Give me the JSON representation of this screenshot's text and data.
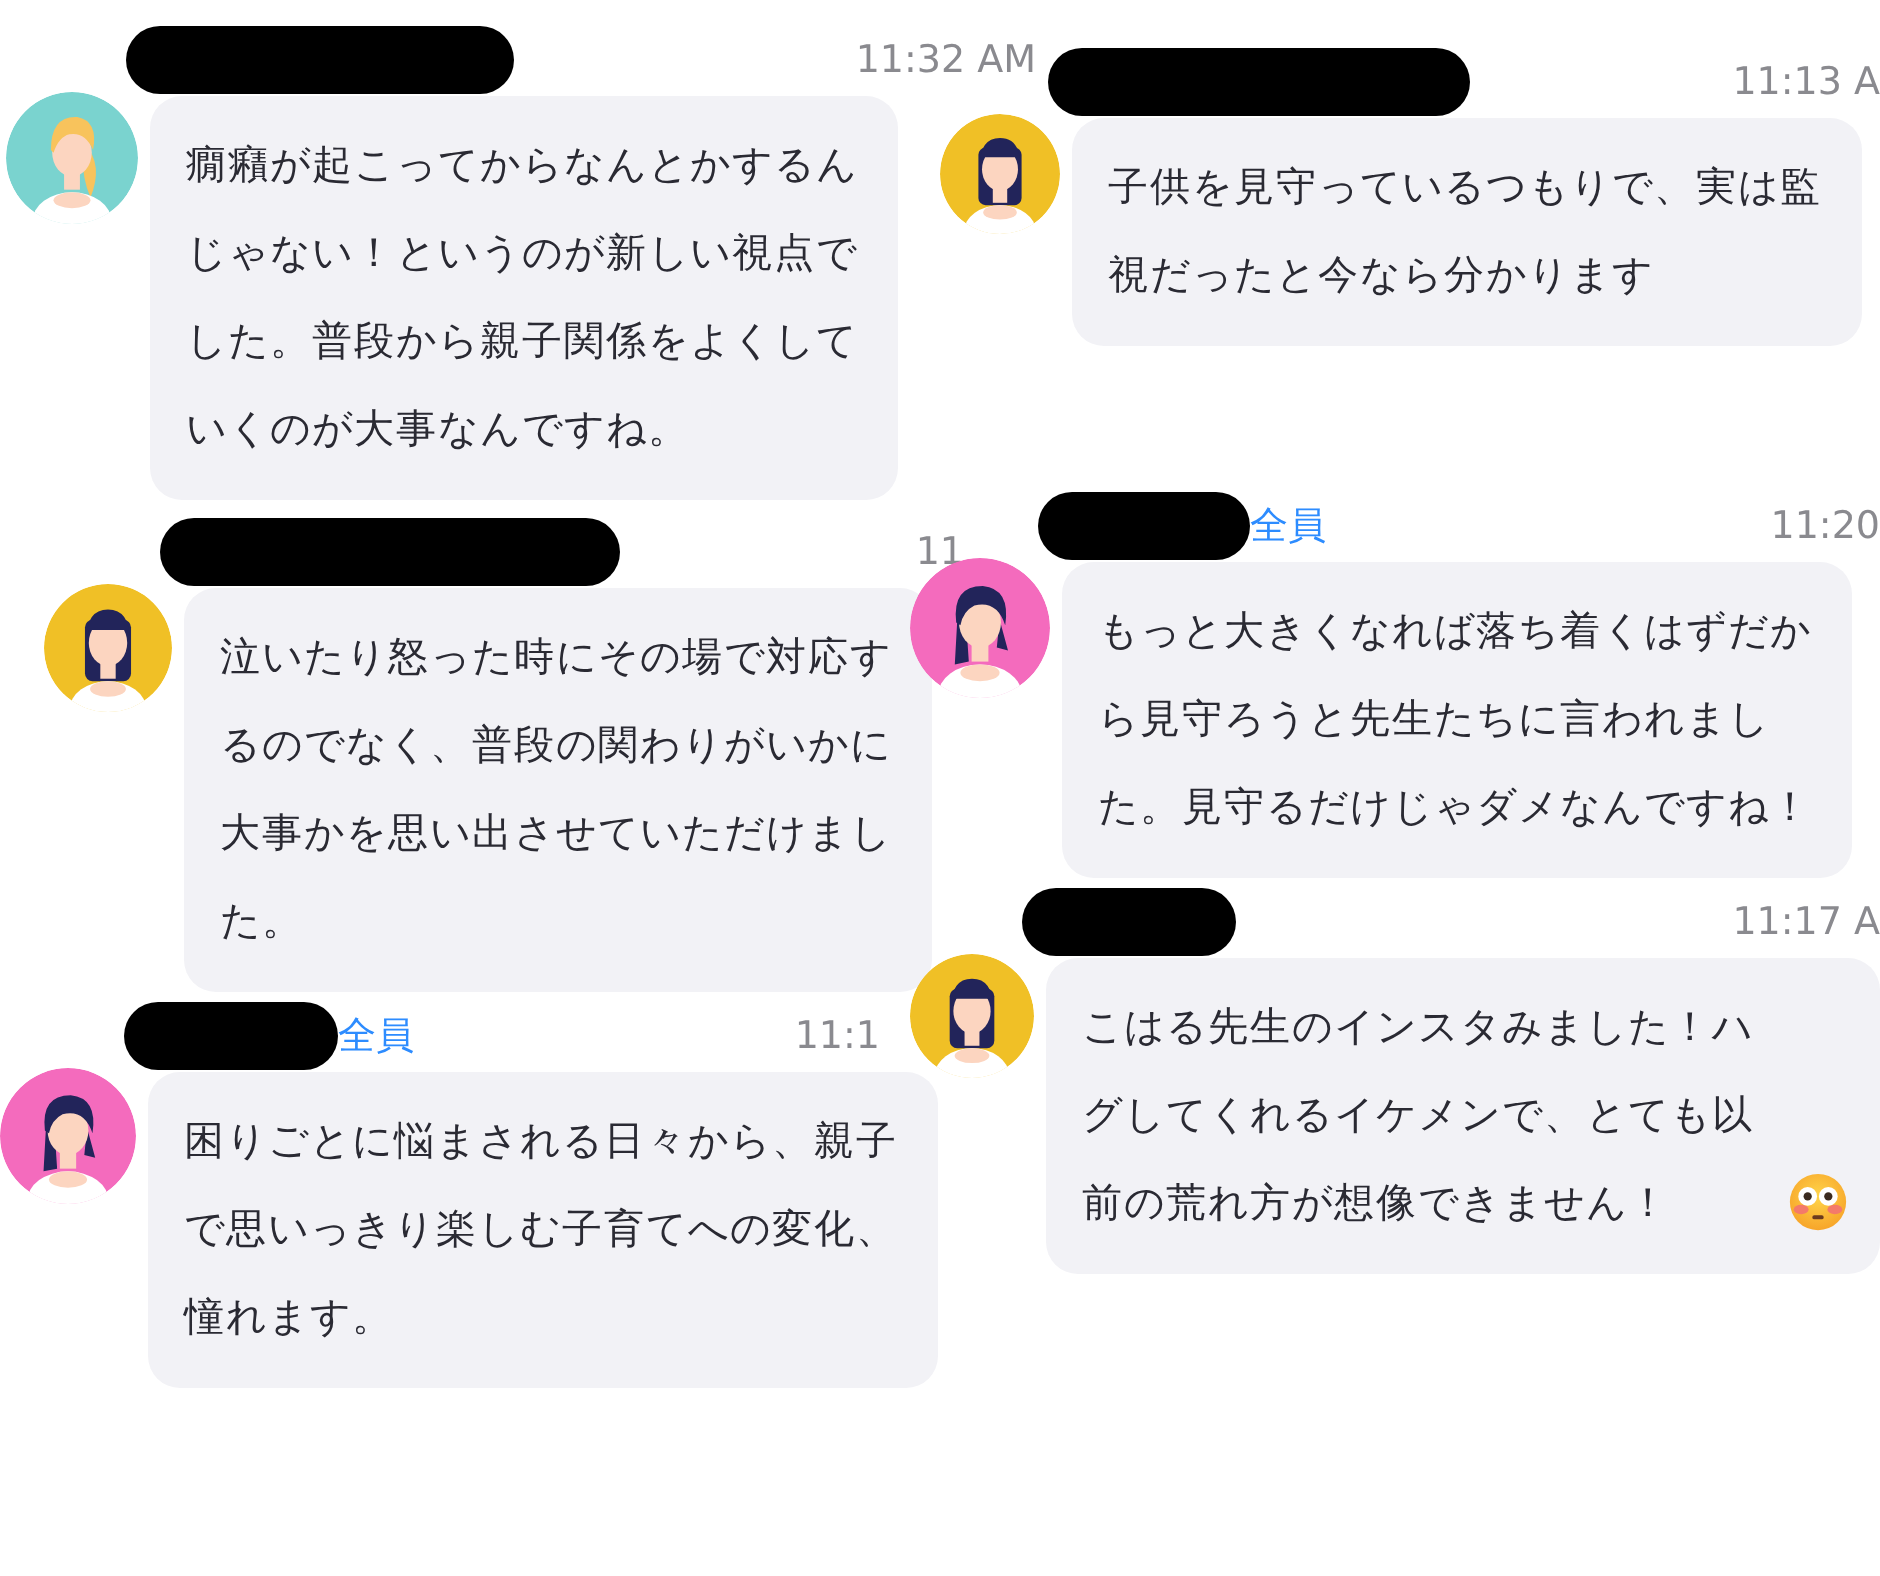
{
  "messages": [
    {
      "sender_redacted": true,
      "time": "11:32 AM",
      "avatar": {
        "color": "#7ad3cf",
        "kind": "blonde"
      },
      "text": "癇癪が起こってからなんとかするんじゃない！というのが新しい視点でした。普段から親子関係をよくしていくのが大事なんですね。"
    },
    {
      "sender_redacted": true,
      "time": "11:13 A",
      "avatar": {
        "color": "#f0c026",
        "kind": "straight"
      },
      "text": "子供を見守っているつもりで、実は監視だったと今なら分かります"
    },
    {
      "sender_redacted": true,
      "time": "11",
      "avatar": {
        "color": "#f0c026",
        "kind": "straight"
      },
      "text": "泣いたり怒った時にその場で対応するのでなく、普段の関わりがいかに大事かを思い出させていただけました。"
    },
    {
      "sender_redacted": true,
      "recipient": "全員",
      "time": "11:20",
      "avatar": {
        "color": "#f46bbd",
        "kind": "side"
      },
      "text": "もっと大きくなれば落ち着くはずだから見守ろうと先生たちに言われました。見守るだけじゃダメなんですね！"
    },
    {
      "sender_redacted": true,
      "recipient": "全員",
      "time": "11:1",
      "avatar": {
        "color": "#f46bbd",
        "kind": "side"
      },
      "text": "困りごとに悩まされる日々から、親子で思いっきり楽しむ子育てへの変化、憧れます。"
    },
    {
      "sender_redacted": true,
      "time": "11:17 A",
      "avatar": {
        "color": "#f0c026",
        "kind": "straight"
      },
      "text": "こはる先生のインスタみました！ハグしてくれるイケメンで、とても以前の荒れ方が想像できません！",
      "emoji": {
        "kind": "flushed"
      }
    }
  ]
}
